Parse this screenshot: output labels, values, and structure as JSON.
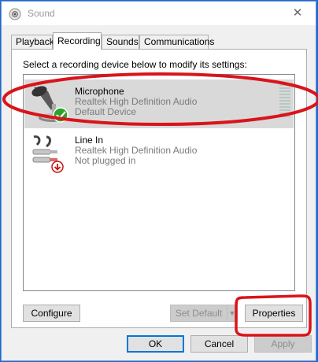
{
  "window": {
    "title": "Sound",
    "close_symbol": "✕"
  },
  "tabs": [
    {
      "label": "Playback",
      "active": false
    },
    {
      "label": "Recording",
      "active": true
    },
    {
      "label": "Sounds",
      "active": false
    },
    {
      "label": "Communications",
      "active": false
    }
  ],
  "recording": {
    "instruction": "Select a recording device below to modify its settings:",
    "devices": [
      {
        "name": "Microphone",
        "driver": "Realtek High Definition Audio",
        "status": "Default Device",
        "selected": true,
        "status_icon": "green-check-icon"
      },
      {
        "name": "Line In",
        "driver": "Realtek High Definition Audio",
        "status": "Not plugged in",
        "selected": false,
        "status_icon": "red-down-arrow-icon"
      }
    ],
    "configure_label": "Configure",
    "set_default_label": "Set Default",
    "set_default_arrow": "▼",
    "properties_label": "Properties"
  },
  "footer": {
    "ok_label": "OK",
    "cancel_label": "Cancel",
    "apply_label": "Apply"
  },
  "colors": {
    "annotation": "#d9141b",
    "selection": "#d9d9d9",
    "desktop": "#1a6ad6"
  }
}
